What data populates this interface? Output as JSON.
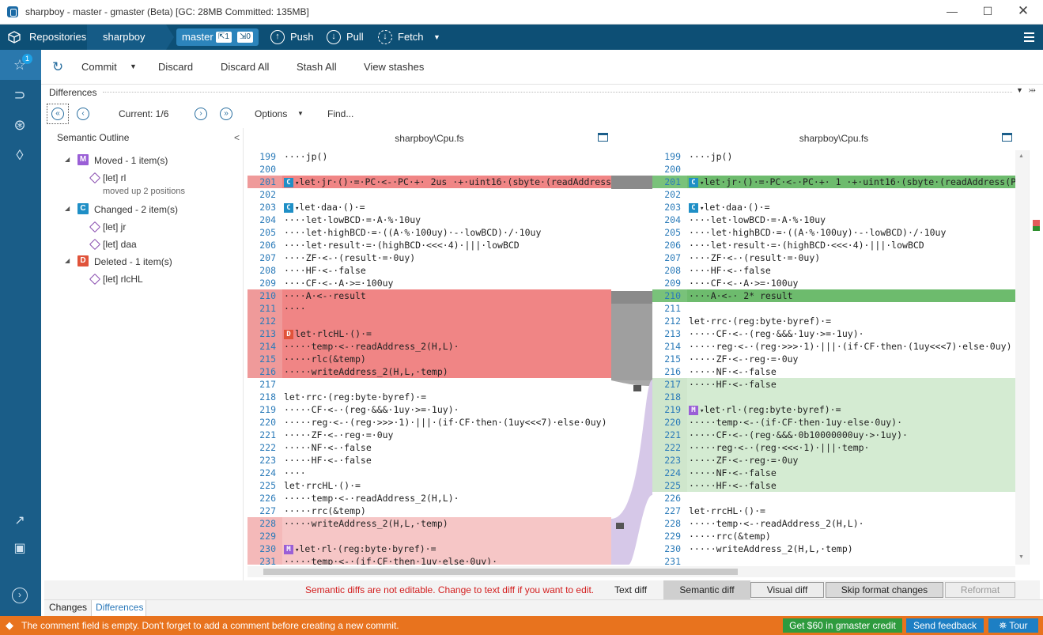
{
  "window": {
    "title": "sharpboy - master - gmaster (Beta) [GC: 28MB Committed: 135MB]"
  },
  "toolbar": {
    "repositories": "Repositories",
    "repo": "sharpboy",
    "branch": "master",
    "ahead": "1",
    "behind": "0",
    "push": "Push",
    "pull": "Pull",
    "fetch": "Fetch"
  },
  "rail": {
    "notification_count": "1"
  },
  "commitbar": {
    "commit": "Commit",
    "discard": "Discard",
    "discard_all": "Discard All",
    "stash_all": "Stash All",
    "view_stashes": "View stashes"
  },
  "differences": {
    "header": "Differences",
    "current": "Current: 1/6",
    "options": "Options",
    "find": "Find..."
  },
  "outline": {
    "title": "Semantic Outline",
    "collapse": "<",
    "groups": [
      {
        "tag": "M",
        "label": "Moved - 1 item(s)",
        "color": "#9a5fd6",
        "items": [
          {
            "label": "[let] rl",
            "note": "moved up 2 positions"
          }
        ]
      },
      {
        "tag": "C",
        "label": "Changed - 2 item(s)",
        "color": "#1f8fc6",
        "items": [
          {
            "label": "[let] jr"
          },
          {
            "label": "[let] daa"
          }
        ]
      },
      {
        "tag": "D",
        "label": "Deleted - 1 item(s)",
        "color": "#e0533a",
        "items": [
          {
            "label": "[let] rlcHL"
          }
        ]
      }
    ]
  },
  "left_pane": {
    "file": "sharpboy\\Cpu.fs",
    "lines": [
      {
        "n": "199",
        "t": "····jp()",
        "bg": ""
      },
      {
        "n": "200",
        "t": "",
        "bg": ""
      },
      {
        "n": "201",
        "t": "let·jr·()·=·PC·<-·PC·+· 2us ·+·uint16·(sbyte·(readAddress(",
        "bg": "red",
        "tag": "C"
      },
      {
        "n": "202",
        "t": "",
        "bg": ""
      },
      {
        "n": "203",
        "t": "let·daa·()·=",
        "bg": "",
        "tag": "C"
      },
      {
        "n": "204",
        "t": "····let·lowBCD·=·A·%·10uy",
        "bg": ""
      },
      {
        "n": "205",
        "t": "····let·highBCD·=·((A·%·100uy)·-·lowBCD)·/·10uy",
        "bg": ""
      },
      {
        "n": "206",
        "t": "····let·result·=·(highBCD·<<<·4)·|||·lowBCD",
        "bg": ""
      },
      {
        "n": "207",
        "t": "····ZF·<-·(result·=·0uy)",
        "bg": ""
      },
      {
        "n": "208",
        "t": "····HF·<-·false",
        "bg": ""
      },
      {
        "n": "209",
        "t": "····CF·<-·A·>=·100uy",
        "bg": ""
      },
      {
        "n": "210",
        "t": "····A·<-·result",
        "bg": "red"
      },
      {
        "n": "211",
        "t": "····",
        "bg": "red"
      },
      {
        "n": "212",
        "t": "",
        "bg": "red"
      },
      {
        "n": "213",
        "t": "let·rlcHL·()·=",
        "bg": "red",
        "tag": "D"
      },
      {
        "n": "214",
        "t": "·····temp·<-·readAddress_2(H,L)·",
        "bg": "red"
      },
      {
        "n": "215",
        "t": "·····rlc(&temp)",
        "bg": "red"
      },
      {
        "n": "216",
        "t": "·····writeAddress_2(H,L,·temp)",
        "bg": "red"
      },
      {
        "n": "217",
        "t": "",
        "bg": ""
      },
      {
        "n": "218",
        "t": "let·rrc·(reg:byte·byref)·=",
        "bg": ""
      },
      {
        "n": "219",
        "t": "·····CF·<-·(reg·&&&·1uy·>=·1uy)·",
        "bg": ""
      },
      {
        "n": "220",
        "t": "·····reg·<-·(reg·>>>·1)·|||·(if·CF·then·(1uy<<<7)·else·0uy)",
        "bg": ""
      },
      {
        "n": "221",
        "t": "·····ZF·<-·reg·=·0uy",
        "bg": ""
      },
      {
        "n": "222",
        "t": "·····NF·<-·false",
        "bg": ""
      },
      {
        "n": "223",
        "t": "·····HF·<-·false",
        "bg": ""
      },
      {
        "n": "224",
        "t": "····",
        "bg": ""
      },
      {
        "n": "225",
        "t": "let·rrcHL·()·=",
        "bg": ""
      },
      {
        "n": "226",
        "t": "·····temp·<-·readAddress_2(H,L)·",
        "bg": ""
      },
      {
        "n": "227",
        "t": "·····rrc(&temp)",
        "bg": ""
      },
      {
        "n": "228",
        "t": "·····writeAddress_2(H,L,·temp)",
        "bg": "pink"
      },
      {
        "n": "229",
        "t": "",
        "bg": "pink"
      },
      {
        "n": "230",
        "t": "let·rl·(reg:byte·byref)·=",
        "bg": "pink",
        "tag": "M"
      },
      {
        "n": "231",
        "t": "·····temp·<-·(if·CF·then·1uy·else·0uy)·",
        "bg": "pink"
      }
    ]
  },
  "right_pane": {
    "file": "sharpboy\\Cpu.fs",
    "lines": [
      {
        "n": "199",
        "t": "····jp()",
        "bg": ""
      },
      {
        "n": "200",
        "t": "",
        "bg": ""
      },
      {
        "n": "201",
        "t": "let·jr·()·=·PC·<-·PC·+· 1 ·+·uint16·(sbyte·(readAddress(P",
        "bg": "green",
        "tag": "C"
      },
      {
        "n": "202",
        "t": "",
        "bg": ""
      },
      {
        "n": "203",
        "t": "let·daa·()·=",
        "bg": "",
        "tag": "C"
      },
      {
        "n": "204",
        "t": "····let·lowBCD·=·A·%·10uy",
        "bg": ""
      },
      {
        "n": "205",
        "t": "····let·highBCD·=·((A·%·100uy)·-·lowBCD)·/·10uy",
        "bg": ""
      },
      {
        "n": "206",
        "t": "····let·result·=·(highBCD·<<<·4)·|||·lowBCD",
        "bg": ""
      },
      {
        "n": "207",
        "t": "····ZF·<-·(result·=·0uy)",
        "bg": ""
      },
      {
        "n": "208",
        "t": "····HF·<-·false",
        "bg": ""
      },
      {
        "n": "209",
        "t": "····CF·<-·A·>=·100uy",
        "bg": ""
      },
      {
        "n": "210",
        "t": "····A·<-· 2* result",
        "bg": "green"
      },
      {
        "n": "211",
        "t": "",
        "bg": ""
      },
      {
        "n": "212",
        "t": "let·rrc·(reg:byte·byref)·=",
        "bg": ""
      },
      {
        "n": "213",
        "t": "·····CF·<-·(reg·&&&·1uy·>=·1uy)·",
        "bg": ""
      },
      {
        "n": "214",
        "t": "·····reg·<-·(reg·>>>·1)·|||·(if·CF·then·(1uy<<<7)·else·0uy)",
        "bg": ""
      },
      {
        "n": "215",
        "t": "·····ZF·<-·reg·=·0uy",
        "bg": ""
      },
      {
        "n": "216",
        "t": "·····NF·<-·false",
        "bg": ""
      },
      {
        "n": "217",
        "t": "·····HF·<-·false",
        "bg": "lgreen"
      },
      {
        "n": "218",
        "t": "",
        "bg": "lgreen"
      },
      {
        "n": "219",
        "t": "let·rl·(reg:byte·byref)·=",
        "bg": "lgreen",
        "tag": "M"
      },
      {
        "n": "220",
        "t": "·····temp·<-·(if·CF·then·1uy·else·0uy)·",
        "bg": "lgreen"
      },
      {
        "n": "221",
        "t": "·····CF·<-·(reg·&&&·0b10000000uy·>·1uy)·",
        "bg": "lgreen"
      },
      {
        "n": "222",
        "t": "·····reg·<-·(reg·<<<·1)·|||·temp·",
        "bg": "lgreen"
      },
      {
        "n": "223",
        "t": "·····ZF·<-·reg·=·0uy",
        "bg": "lgreen"
      },
      {
        "n": "224",
        "t": "·····NF·<-·false",
        "bg": "lgreen"
      },
      {
        "n": "225",
        "t": "·····HF·<-·false",
        "bg": "lgreen"
      },
      {
        "n": "226",
        "t": "",
        "bg": ""
      },
      {
        "n": "227",
        "t": "let·rrcHL·()·=",
        "bg": ""
      },
      {
        "n": "228",
        "t": "·····temp·<-·readAddress_2(H,L)·",
        "bg": ""
      },
      {
        "n": "229",
        "t": "·····rrc(&temp)",
        "bg": ""
      },
      {
        "n": "230",
        "t": "·····writeAddress_2(H,L,·temp)",
        "bg": ""
      },
      {
        "n": "231",
        "t": "",
        "bg": ""
      }
    ]
  },
  "bottom": {
    "warning": "Semantic diffs are not editable. Change to text diff if you want to edit.",
    "text_diff": "Text diff",
    "semantic_diff": "Semantic diff",
    "visual_diff": "Visual diff",
    "skip_format": "Skip format changes",
    "reformat": "Reformat"
  },
  "tabs": {
    "changes": "Changes",
    "differences": "Differences"
  },
  "status": {
    "message": "The comment field is empty. Don't forget to add a comment before creating a new commit.",
    "credit": "Get $60 in gmaster credit",
    "feedback": "Send feedback",
    "tour": "Tour"
  },
  "colors": {
    "red": "#f08585",
    "pink": "#f6c6c6",
    "green": "#6dbb6d",
    "lgreen": "#d4ebd2",
    "toolbar": "#0d4f75",
    "status": "#e8731e"
  }
}
